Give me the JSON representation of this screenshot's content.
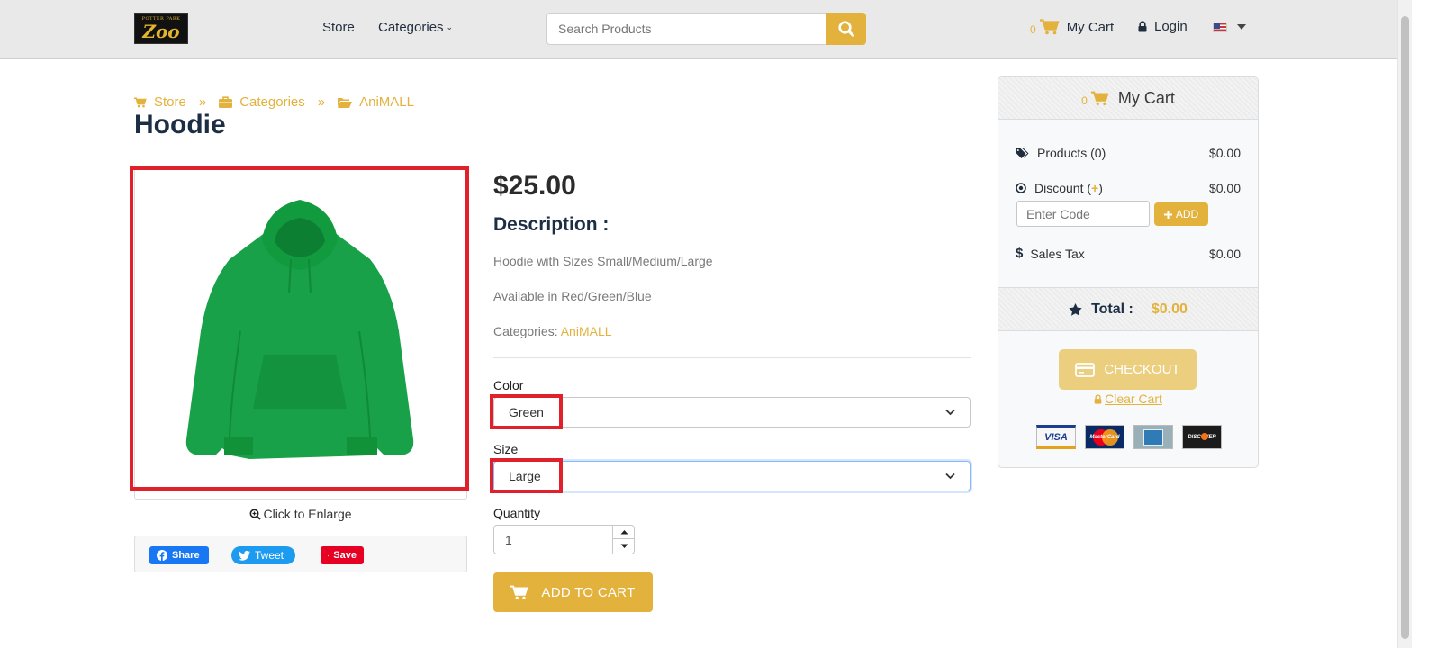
{
  "header": {
    "logo_small_text": "POTTER PARK",
    "logo_main_text": "Zoo",
    "nav": {
      "store": "Store",
      "categories": "Categories"
    },
    "search_placeholder": "Search Products",
    "cart_count": "0",
    "cart_label": "My Cart",
    "login_label": "Login"
  },
  "breadcrumb": {
    "store": "Store",
    "categories": "Categories",
    "current": "AniMALL"
  },
  "product": {
    "title": "Hoodie",
    "price": "$25.00",
    "description_heading": "Description :",
    "description_lines": [
      "Hoodie with Sizes Small/Medium/Large",
      "Available in Red/Green/Blue"
    ],
    "categories_label": "Categories:",
    "category": "AniMALL",
    "image_color": "#16a34a",
    "enlarge_label": "Click to Enlarge",
    "share": {
      "facebook": "Share",
      "twitter": "Tweet",
      "pinterest": "Save"
    },
    "options": {
      "color_label": "Color",
      "color_value": "Green",
      "size_label": "Size",
      "size_value": "Large",
      "quantity_label": "Quantity",
      "quantity_value": "1"
    },
    "add_to_cart_label": "ADD TO CART"
  },
  "cart": {
    "count": "0",
    "title": "My Cart",
    "products_label": "Products (0)",
    "products_amount": "$0.00",
    "discount_label": "Discount (",
    "discount_plus": "+",
    "discount_close": ")",
    "discount_amount": "$0.00",
    "code_placeholder": "Enter Code",
    "code_add_label": "ADD",
    "tax_label": "Sales Tax",
    "tax_amount": "$0.00",
    "total_label": "Total :",
    "total_amount": "$0.00",
    "checkout_label": "CHECKOUT",
    "clear_label": "Clear Cart",
    "card_labels": {
      "visa": "VISA",
      "mastercard": "MasterCard",
      "discover": "DISCOVER"
    }
  },
  "colors": {
    "accent": "#e3b23c",
    "highlight": "#e0202a",
    "title": "#1c2e44"
  }
}
